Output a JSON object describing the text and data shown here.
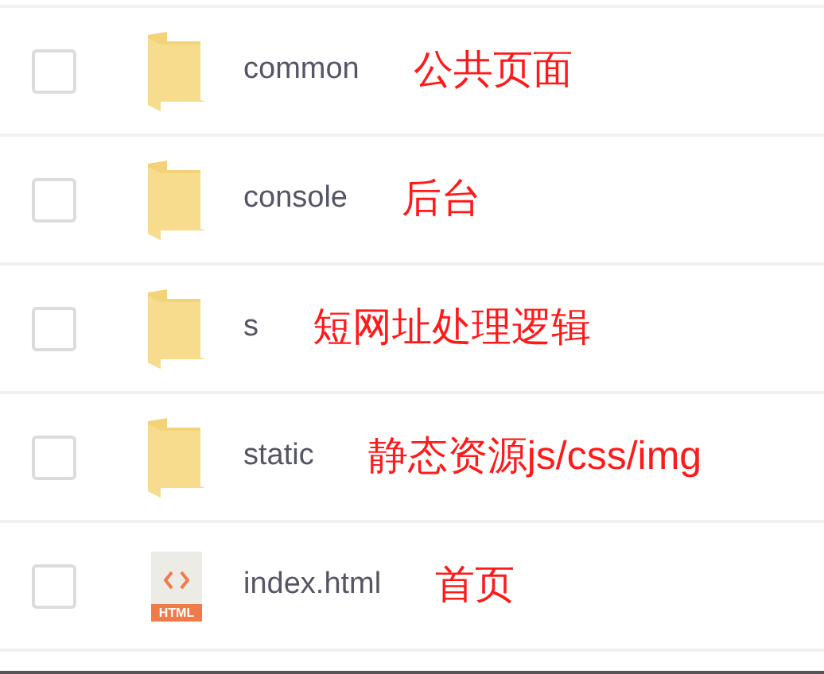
{
  "files": [
    {
      "kind": "folder",
      "name": "common",
      "note": "公共页面",
      "checked": false
    },
    {
      "kind": "folder",
      "name": "console",
      "note": "后台",
      "checked": false
    },
    {
      "kind": "folder",
      "name": "s",
      "note": "短网址处理逻辑",
      "checked": false
    },
    {
      "kind": "folder",
      "name": "static",
      "note": "静态资源js/css/img",
      "checked": false
    },
    {
      "kind": "html",
      "name": "index.html",
      "note": "首页",
      "badge": "HTML",
      "checked": false
    }
  ]
}
